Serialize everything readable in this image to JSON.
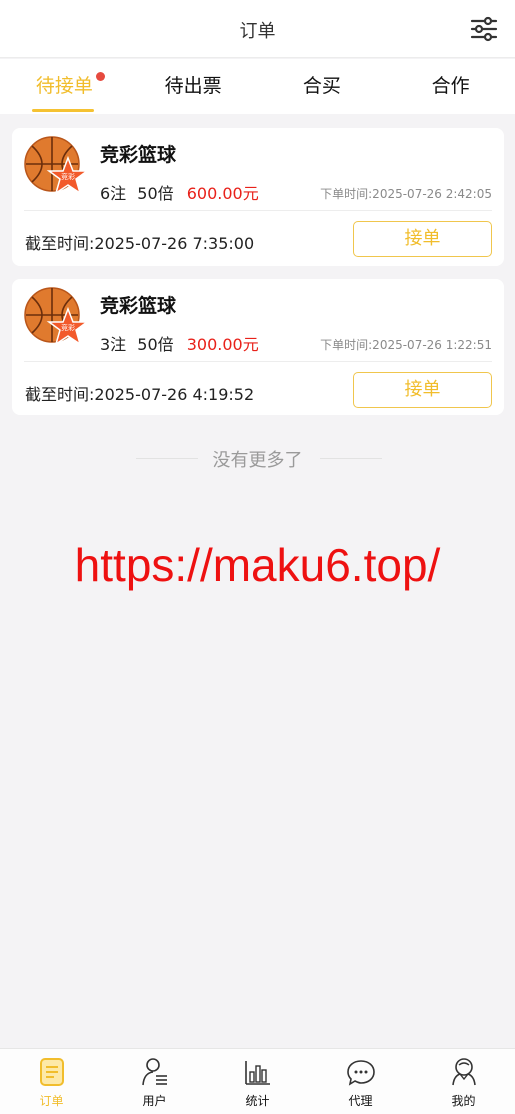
{
  "header": {
    "title": "订单",
    "filter_icon": "sliders-icon"
  },
  "tabs": [
    {
      "label": "待接单",
      "active": true,
      "badge_dot": true
    },
    {
      "label": "待出票",
      "active": false
    },
    {
      "label": "合买",
      "active": false
    },
    {
      "label": "合作",
      "active": false
    }
  ],
  "orders": [
    {
      "game": "竞彩篮球",
      "icon": "basketball-star-icon",
      "bet_count": "6注",
      "multiplier": "50倍",
      "amount": "600.00元",
      "order_time": "下单时间:2025-07-26 2:42:05",
      "deadline": "截至时间:2025-07-26 7:35:00",
      "button": "接单"
    },
    {
      "game": "竞彩篮球",
      "icon": "basketball-star-icon",
      "bet_count": "3注",
      "multiplier": "50倍",
      "amount": "300.00元",
      "order_time": "下单时间:2025-07-26 1:22:51",
      "deadline": "截至时间:2025-07-26 4:19:52",
      "button": "接单"
    }
  ],
  "no_more": "没有更多了",
  "watermark": "https://maku6.top/",
  "bottom_nav": [
    {
      "label": "订单",
      "icon": "document-icon",
      "active": true
    },
    {
      "label": "用户",
      "icon": "user-list-icon",
      "active": false
    },
    {
      "label": "统计",
      "icon": "bar-chart-icon",
      "active": false
    },
    {
      "label": "代理",
      "icon": "chat-bubble-icon",
      "active": false
    },
    {
      "label": "我的",
      "icon": "profile-icon",
      "active": false
    }
  ],
  "colors": {
    "accent": "#f1bd2c",
    "amount": "#e8211a",
    "badge": "#e64a3f"
  }
}
